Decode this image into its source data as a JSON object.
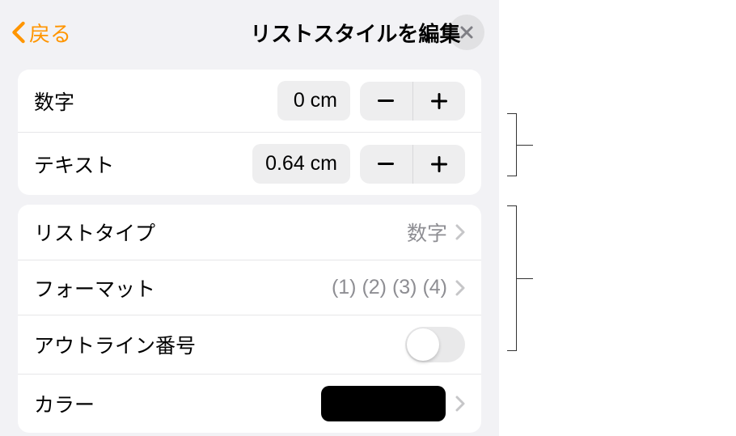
{
  "header": {
    "back_label": "戻る",
    "title": "リストスタイルを編集"
  },
  "indent": {
    "number_label": "数字",
    "number_value": "0 cm",
    "text_label": "テキスト",
    "text_value": "0.64 cm"
  },
  "list": {
    "type_label": "リストタイプ",
    "type_value": "数字",
    "format_label": "フォーマット",
    "format_value": "(1) (2) (3) (4)",
    "outline_label": "アウトライン番号",
    "outline_on": false,
    "color_label": "カラー",
    "color_value": "#000000"
  }
}
